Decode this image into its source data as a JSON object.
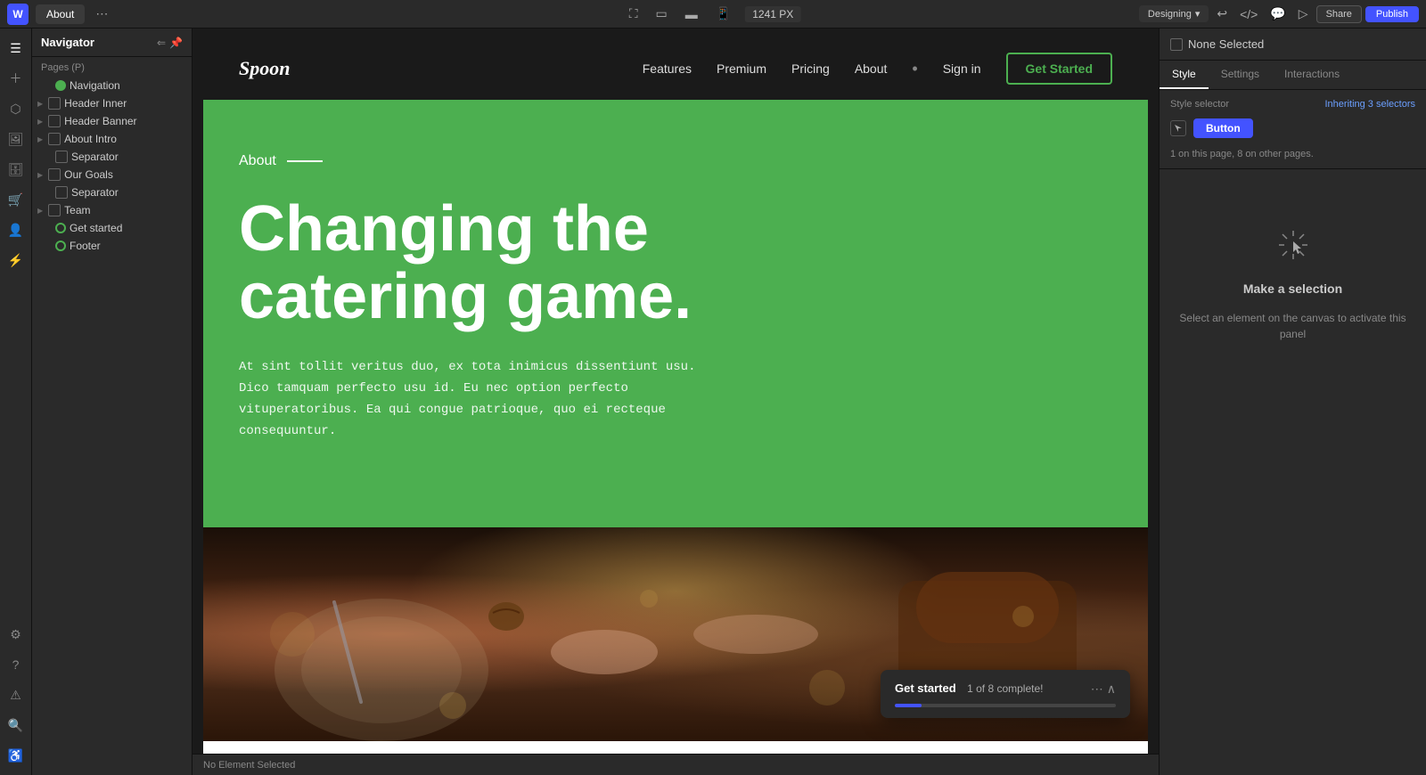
{
  "topbar": {
    "logo": "W",
    "tab_label": "About",
    "more_icon": "⋯",
    "fullscreen_icon": "⛶",
    "tablet_icon": "▭",
    "mobile_icon": "▯",
    "phone_icon": "📱",
    "px_value": "1241 PX",
    "designing_label": "Designing",
    "undo_icon": "↩",
    "code_icon": "</>",
    "comment_icon": "💬",
    "preview_icon": "▷",
    "share_label": "Share",
    "publish_label": "Publish"
  },
  "navigator": {
    "title": "Navigator",
    "pages_label": "Pages (P)",
    "items": [
      {
        "label": "Navigation",
        "type": "circle",
        "level": 1
      },
      {
        "label": "Header Inner",
        "type": "box",
        "level": 2
      },
      {
        "label": "Header Banner",
        "type": "box",
        "level": 2
      },
      {
        "label": "About Intro",
        "type": "box",
        "level": 2
      },
      {
        "label": "Separator",
        "type": "box",
        "level": 2
      },
      {
        "label": "Our Goals",
        "type": "box",
        "level": 2
      },
      {
        "label": "Separator",
        "type": "box",
        "level": 2
      },
      {
        "label": "Team",
        "type": "box",
        "level": 1
      },
      {
        "label": "Get started",
        "type": "circle",
        "level": 1
      },
      {
        "label": "Footer",
        "type": "circle",
        "level": 1
      }
    ]
  },
  "site": {
    "logo": "Spoon",
    "nav_links": [
      "Features",
      "Premium",
      "Pricing",
      "About"
    ],
    "nav_signin": "Sign in",
    "nav_cta": "Get Started",
    "about_label": "About",
    "hero_title": "Changing the catering game.",
    "hero_desc": "At sint tollit veritus duo, ex tota inimicus dissentiunt usu. Dico tamquam perfecto usu id. Eu nec option perfecto vituperatoribus. Ea qui congue patrioque, quo ei recteque consequuntur."
  },
  "right_panel": {
    "none_selected": "None Selected",
    "tab_style": "Style",
    "tab_settings": "Settings",
    "tab_interactions": "Interactions",
    "style_selector_label": "Style selector",
    "style_selector_value": "Inheriting 3 selectors",
    "button_label": "Button",
    "on_page_note": "1 on this page, 8 on other pages.",
    "make_selection_title": "Make a selection",
    "make_selection_desc": "Select an element on the canvas to activate this panel"
  },
  "toast": {
    "title": "Get started",
    "subtitle": "1 of 8 complete!",
    "progress_percent": 12
  },
  "canvas_bottom": {
    "label": "No Element Selected"
  }
}
